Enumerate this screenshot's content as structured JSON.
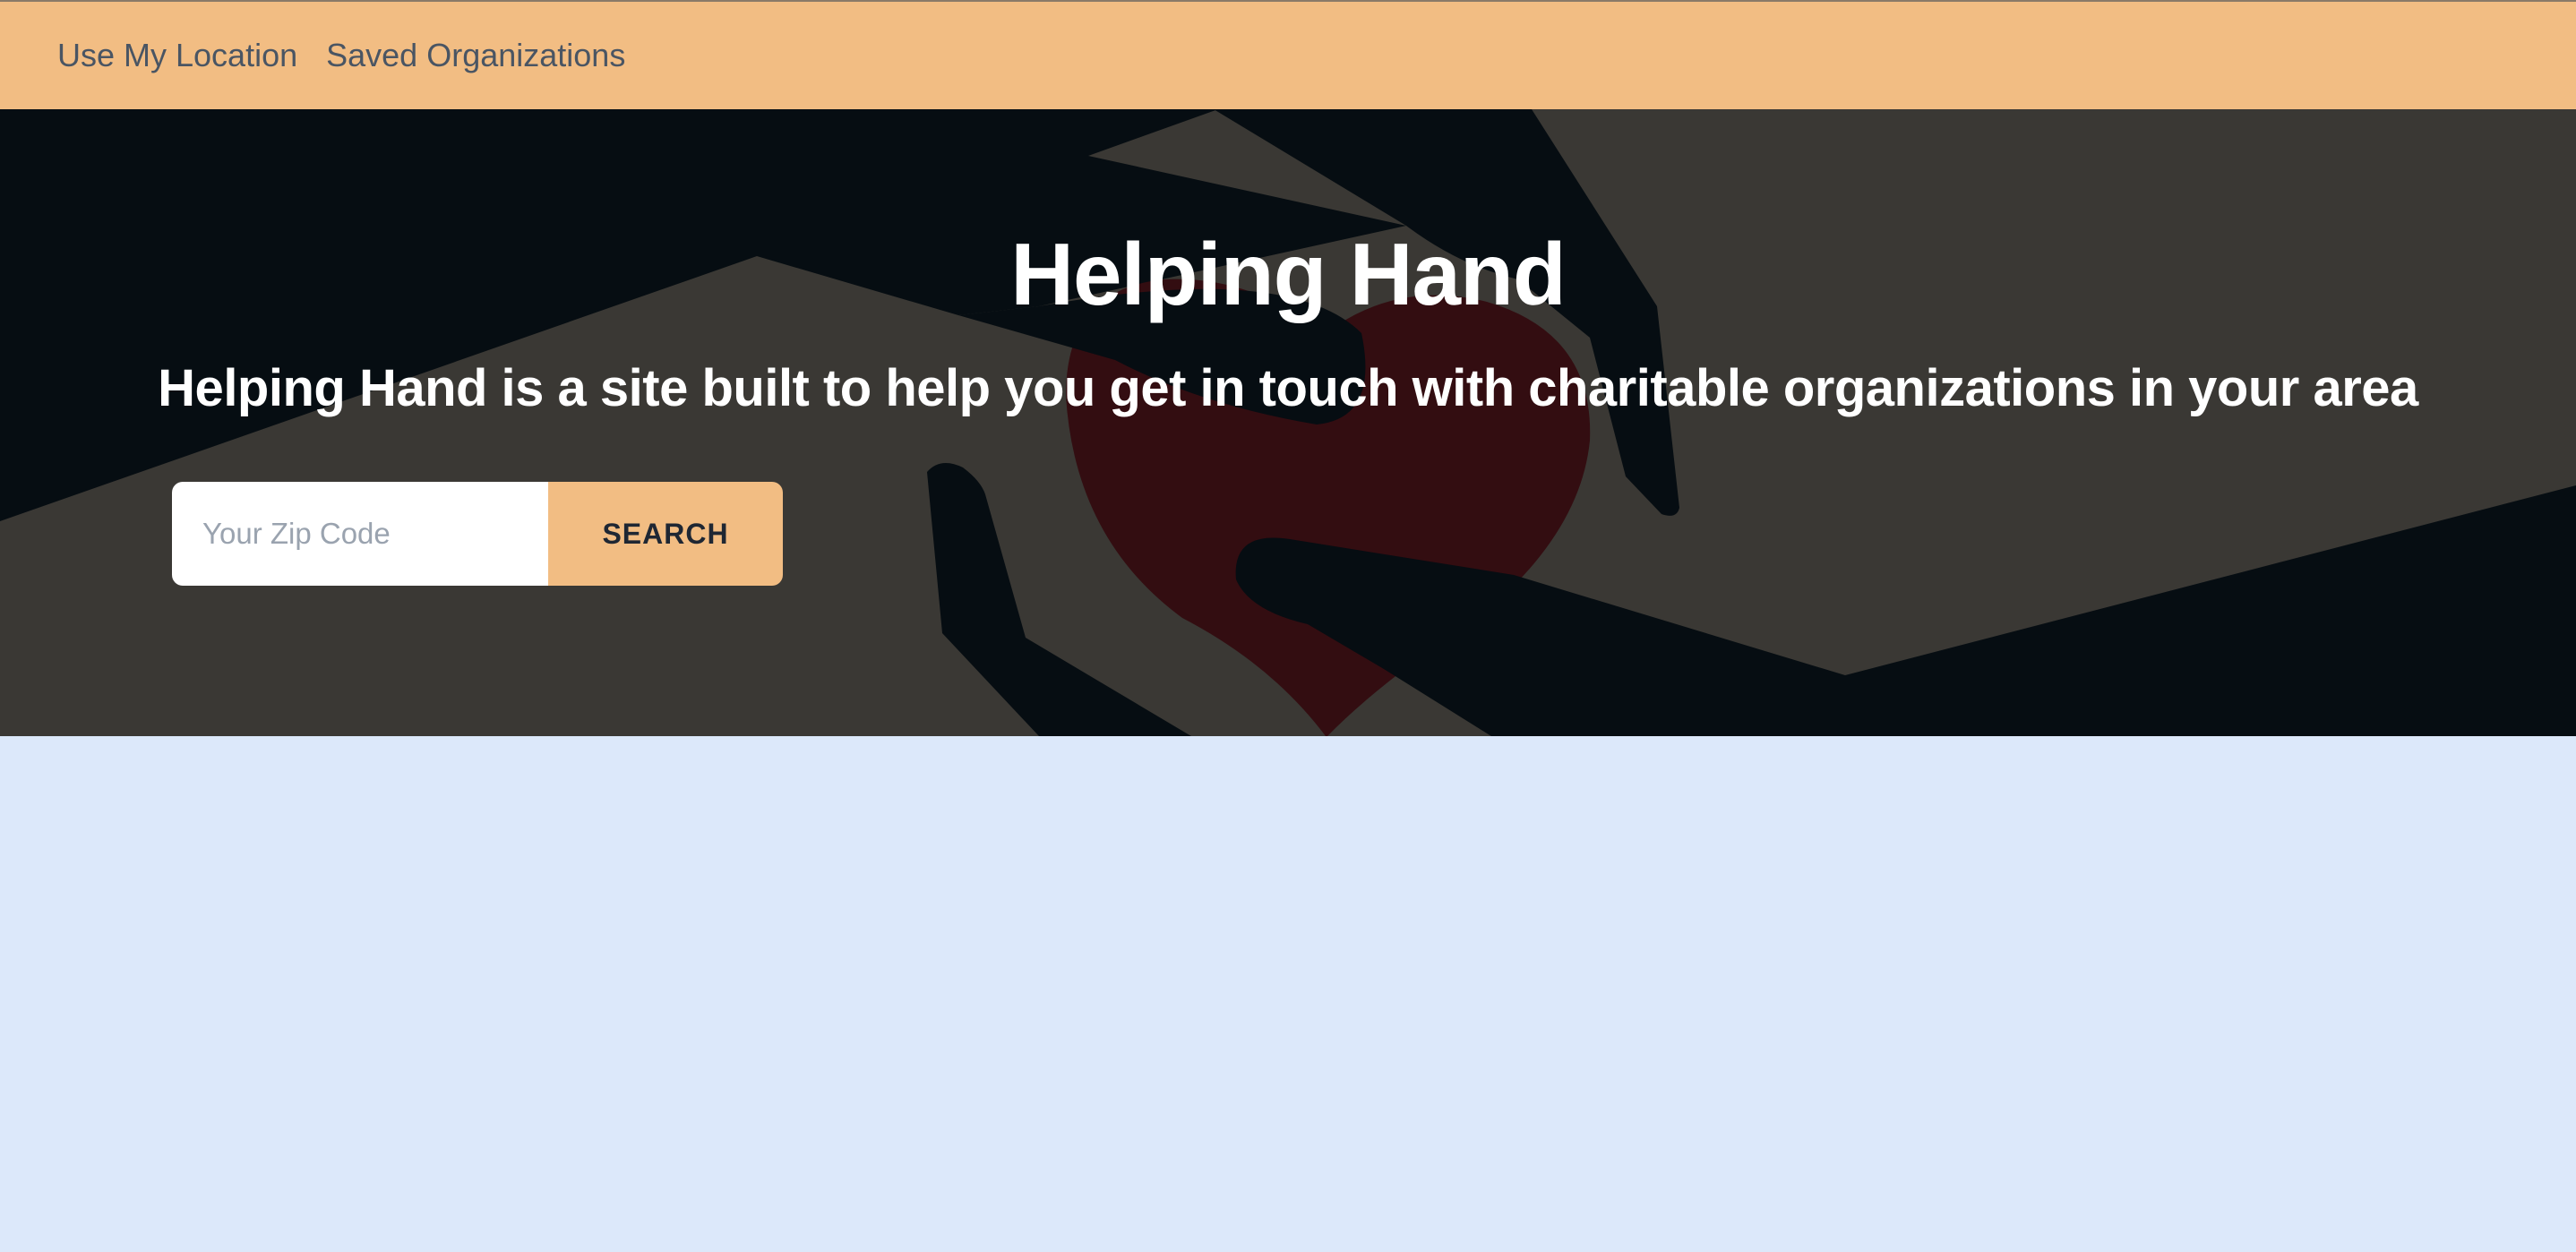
{
  "nav": {
    "items": [
      {
        "label": "Use My Location"
      },
      {
        "label": "Saved Organizations"
      }
    ]
  },
  "hero": {
    "title": "Helping Hand",
    "subtitle": "Helping Hand is a site built to help you get in touch with charitable organizations in your area",
    "background_image": "hands-holding-heart-illustration"
  },
  "search": {
    "placeholder": "Your Zip Code",
    "value": "",
    "button_label": "SEARCH"
  },
  "colors": {
    "navbar": "#f2bd83",
    "hero_dark": "#060d12",
    "hero_gray": "#3a3834",
    "heart": "#330d11",
    "page_background": "#dce8fa",
    "search_button": "#f2bd83"
  }
}
